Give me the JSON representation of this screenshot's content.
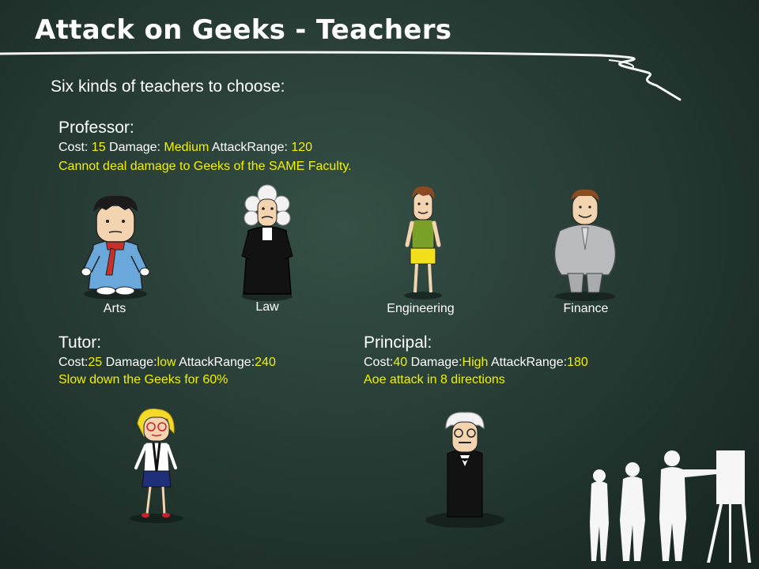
{
  "slide": {
    "title": "Attack on Geeks - Teachers",
    "intro": "Six kinds of teachers to choose:"
  },
  "professor": {
    "heading": "Professor:",
    "cost_label": "Cost: ",
    "cost": "15",
    "damage_label": " Damage: ",
    "damage": "Medium",
    "range_label": " AttackRange: ",
    "range": "120",
    "description": "Cannot deal damage to Geeks of the SAME Faculty.",
    "faculties": [
      "Arts",
      "Law",
      "Engineering",
      "Finance"
    ]
  },
  "tutor": {
    "heading": "Tutor:",
    "cost_label": "Cost:",
    "cost": "25",
    "damage_label": " Damage:",
    "damage": "low",
    "range_label": " AttackRange:",
    "range": "240",
    "description": "Slow down the Geeks for 60%"
  },
  "principal": {
    "heading": "Principal:",
    "cost_label": "Cost:",
    "cost": "40",
    "damage_label": " Damage:",
    "damage": "High",
    "range_label": " AttackRange:",
    "range": "180",
    "description": "Aoe attack in 8 directions"
  },
  "colors": {
    "background": "#273c35",
    "highlight": "#f2f200",
    "text": "#ffffff"
  },
  "icons": [
    "arts-professor-figure",
    "law-professor-figure",
    "engineering-professor-figure",
    "finance-professor-figure",
    "tutor-figure",
    "principal-figure",
    "presenter-silhouette"
  ]
}
